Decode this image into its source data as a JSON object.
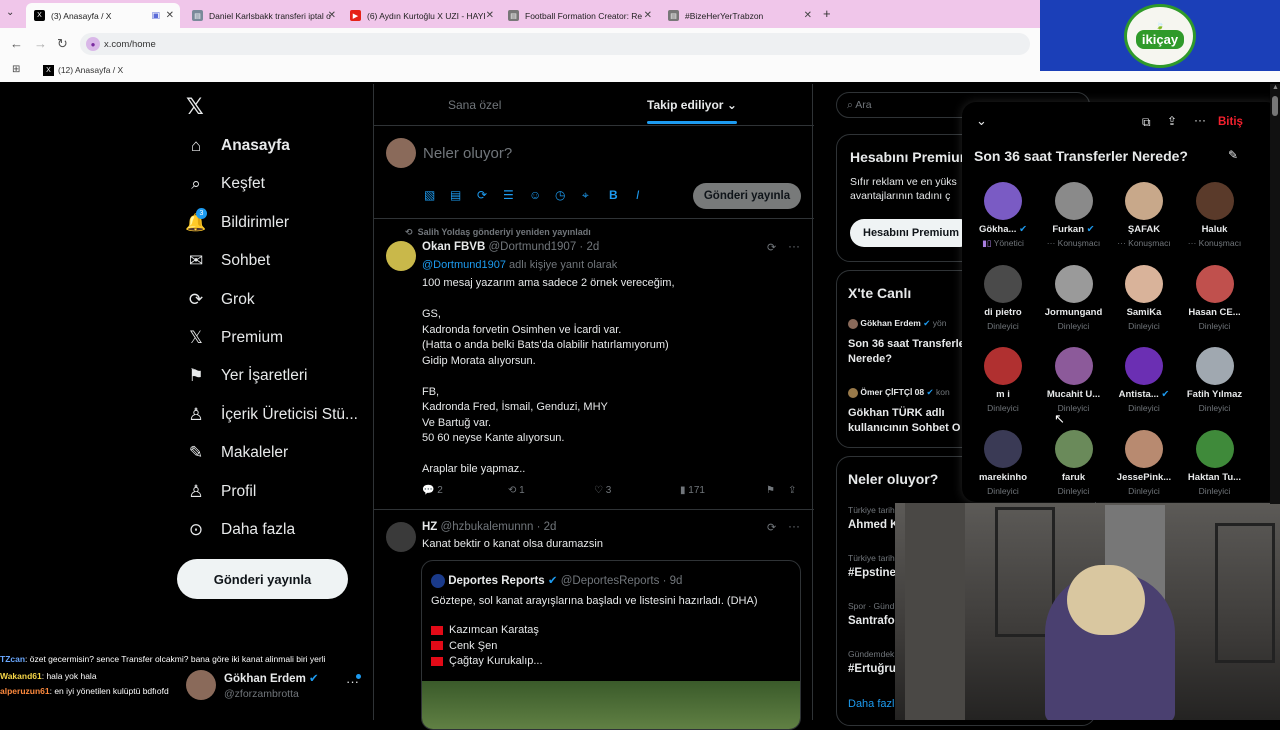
{
  "browser": {
    "tabs": [
      {
        "title": "(3) Anasayfa / X",
        "active": true
      },
      {
        "title": "Daniel Karlsbakk transferi iptal o"
      },
      {
        "title": "(6) Aydın Kurtoğlu X UZI - HAYI"
      },
      {
        "title": "Football Formation Creator: Re"
      },
      {
        "title": "#BizeHerYerTrabzon"
      }
    ],
    "new_tab": "+",
    "url": "x.com/home",
    "bookmark": "(12) Anasayfa / X"
  },
  "brand_logo": "ikiçay",
  "nav": {
    "items": [
      {
        "label": "Anasayfa",
        "icon": "home-icon"
      },
      {
        "label": "Keşfet",
        "icon": "search-icon"
      },
      {
        "label": "Bildirimler",
        "icon": "bell-icon",
        "badge": "3"
      },
      {
        "label": "Sohbet",
        "icon": "mail-icon"
      },
      {
        "label": "Grok",
        "icon": "grok-icon"
      },
      {
        "label": "Premium",
        "icon": "x-icon"
      },
      {
        "label": "Yer İşaretleri",
        "icon": "bookmark-icon"
      },
      {
        "label": "İçerik Üreticisi Stü...",
        "icon": "creator-icon"
      },
      {
        "label": "Makaleler",
        "icon": "article-icon"
      },
      {
        "label": "Profil",
        "icon": "person-icon"
      },
      {
        "label": "Daha fazla",
        "icon": "more-circle-icon"
      }
    ],
    "post_button": "Gönderi yayınla"
  },
  "chat": [
    {
      "user": "TZcan",
      "text": ": özet gecermisin? sence Transfer olcakmi? bana göre iki kanat alinmali biri yerli",
      "color": "#6aa8ff"
    },
    {
      "user": "Wakand61",
      "text": ": hala yok hala",
      "color": "#f5d547"
    },
    {
      "user": "alperuzun61",
      "text": ": en iyi yönetilen kulüptü bdfıofd",
      "color": "#ff8a3d"
    }
  ],
  "account": {
    "name": "Gökhan Erdem",
    "handle": "@zforzambrotta"
  },
  "timeline": {
    "tabs": [
      "Sana özel",
      "Takip ediliyor"
    ],
    "compose_placeholder": "Neler oluyor?",
    "compose_button": "Gönderi yayınla",
    "tweets": [
      {
        "repost_note": "Salih Yoldaş gönderiyi yeniden yayınladı",
        "name": "Okan FBVB",
        "handle": "@Dortmund1907",
        "time": "· 2d",
        "reply_to_handle": "@Dortmund1907",
        "reply_to_suffix": "adlı kişiye yanıt olarak",
        "text": "100 mesaj yazarım ama sadece 2 örnek vereceğim,\n\nGS,\nKadronda forvetin Osimhen ve İcardi var.\n(Hatta o anda belki Bats'da olabilir hatırlamıyorum)\nGidip Morata alıyorsun.\n\nFB,\nKadronda Fred, İsmail, Genduzi, MHY\nVe Bartuğ var.\n50 60 neyse Kante alıyorsun.\n\nAraplar bile yapmaz..",
        "replies": "2",
        "reposts": "1",
        "likes": "3",
        "views": "171"
      },
      {
        "name": "HZ",
        "handle": "@hzbukalemunnn",
        "time": "· 2d",
        "text": "Kanat bektir o kanat olsa duramazsin",
        "quote": {
          "name": "Deportes Reports",
          "handle": "@DeportesReports",
          "time": "· 9d",
          "text": "Göztepe, sol kanat arayışlarına başladı ve listesini hazırladı. (DHA)",
          "list": [
            "Kazımcan Karataş",
            "Cenk Şen",
            "Çağtay Kurukalıp..."
          ]
        }
      }
    ]
  },
  "right": {
    "search_placeholder": "Ara",
    "premium": {
      "title": "Hesabını Premium",
      "body": "Sıfır reklam ve en yüks avantajlarının tadını ç",
      "button": "Hesabını Premium"
    },
    "live": {
      "title": "X'te Canlı",
      "items": [
        {
          "host": "Gökhan Erdem",
          "suffix": "yön",
          "title": "Son 36 saat Transferle Nerede?"
        },
        {
          "host": "Ömer ÇİFTÇİ 08",
          "suffix": "kon",
          "title": "Gökhan TÜRK adlı kullanıcının Sohbet O"
        }
      ]
    },
    "trends": {
      "title": "Neler oluyor?",
      "items": [
        {
          "meta": "Türkiye tarih",
          "name": "Ahmed K"
        },
        {
          "meta": "Türkiye tarih",
          "name": "#Epstine"
        },
        {
          "meta": "Spor · Günd",
          "name": "Santrafor"
        },
        {
          "meta": "Gündemdek",
          "name": "#Ertuğru"
        }
      ],
      "more": "Daha fazl"
    }
  },
  "space": {
    "end_label": "Bitiş",
    "title": "Son 36 saat Transferler Nerede?",
    "participants": [
      {
        "name": "Gökha...",
        "role": "Yönetici",
        "verified": true,
        "color": "#7a5bc4"
      },
      {
        "name": "Furkan",
        "role": "Konuşmacı",
        "verified": true,
        "color": "#8a8a8a"
      },
      {
        "name": "ŞAFAK",
        "role": "Konuşmacı",
        "color": "#c8a88a"
      },
      {
        "name": "Haluk",
        "role": "Konuşmacı",
        "color": "#5a3a2a"
      },
      {
        "name": "di pietro",
        "role": "Dinleyici",
        "color": "#4a4a4a"
      },
      {
        "name": "Jormungand",
        "role": "Dinleyici",
        "color": "#9a9a9a"
      },
      {
        "name": "SamiKa",
        "role": "Dinleyici",
        "color": "#d9b39a"
      },
      {
        "name": "Hasan CE...",
        "role": "Dinleyici",
        "color": "#c0504d"
      },
      {
        "name": "m i",
        "role": "Dinleyici",
        "color": "#b03030"
      },
      {
        "name": "Mucahit U...",
        "role": "Dinleyici",
        "color": "#8c5a9a"
      },
      {
        "name": "Antista...",
        "role": "Dinleyici",
        "verified": true,
        "color": "#6b2fb3"
      },
      {
        "name": "Fatih Yılmaz",
        "role": "Dinleyici",
        "color": "#a0a8b0"
      },
      {
        "name": "marekinho",
        "role": "Dinleyici",
        "color": "#3a3a55"
      },
      {
        "name": "faruk",
        "role": "Dinleyici",
        "color": "#6a8a5a"
      },
      {
        "name": "JessePink...",
        "role": "Dinleyici",
        "color": "#b88a70"
      },
      {
        "name": "Haktan Tu...",
        "role": "Dinleyici",
        "color": "#3f8a3a"
      }
    ]
  }
}
